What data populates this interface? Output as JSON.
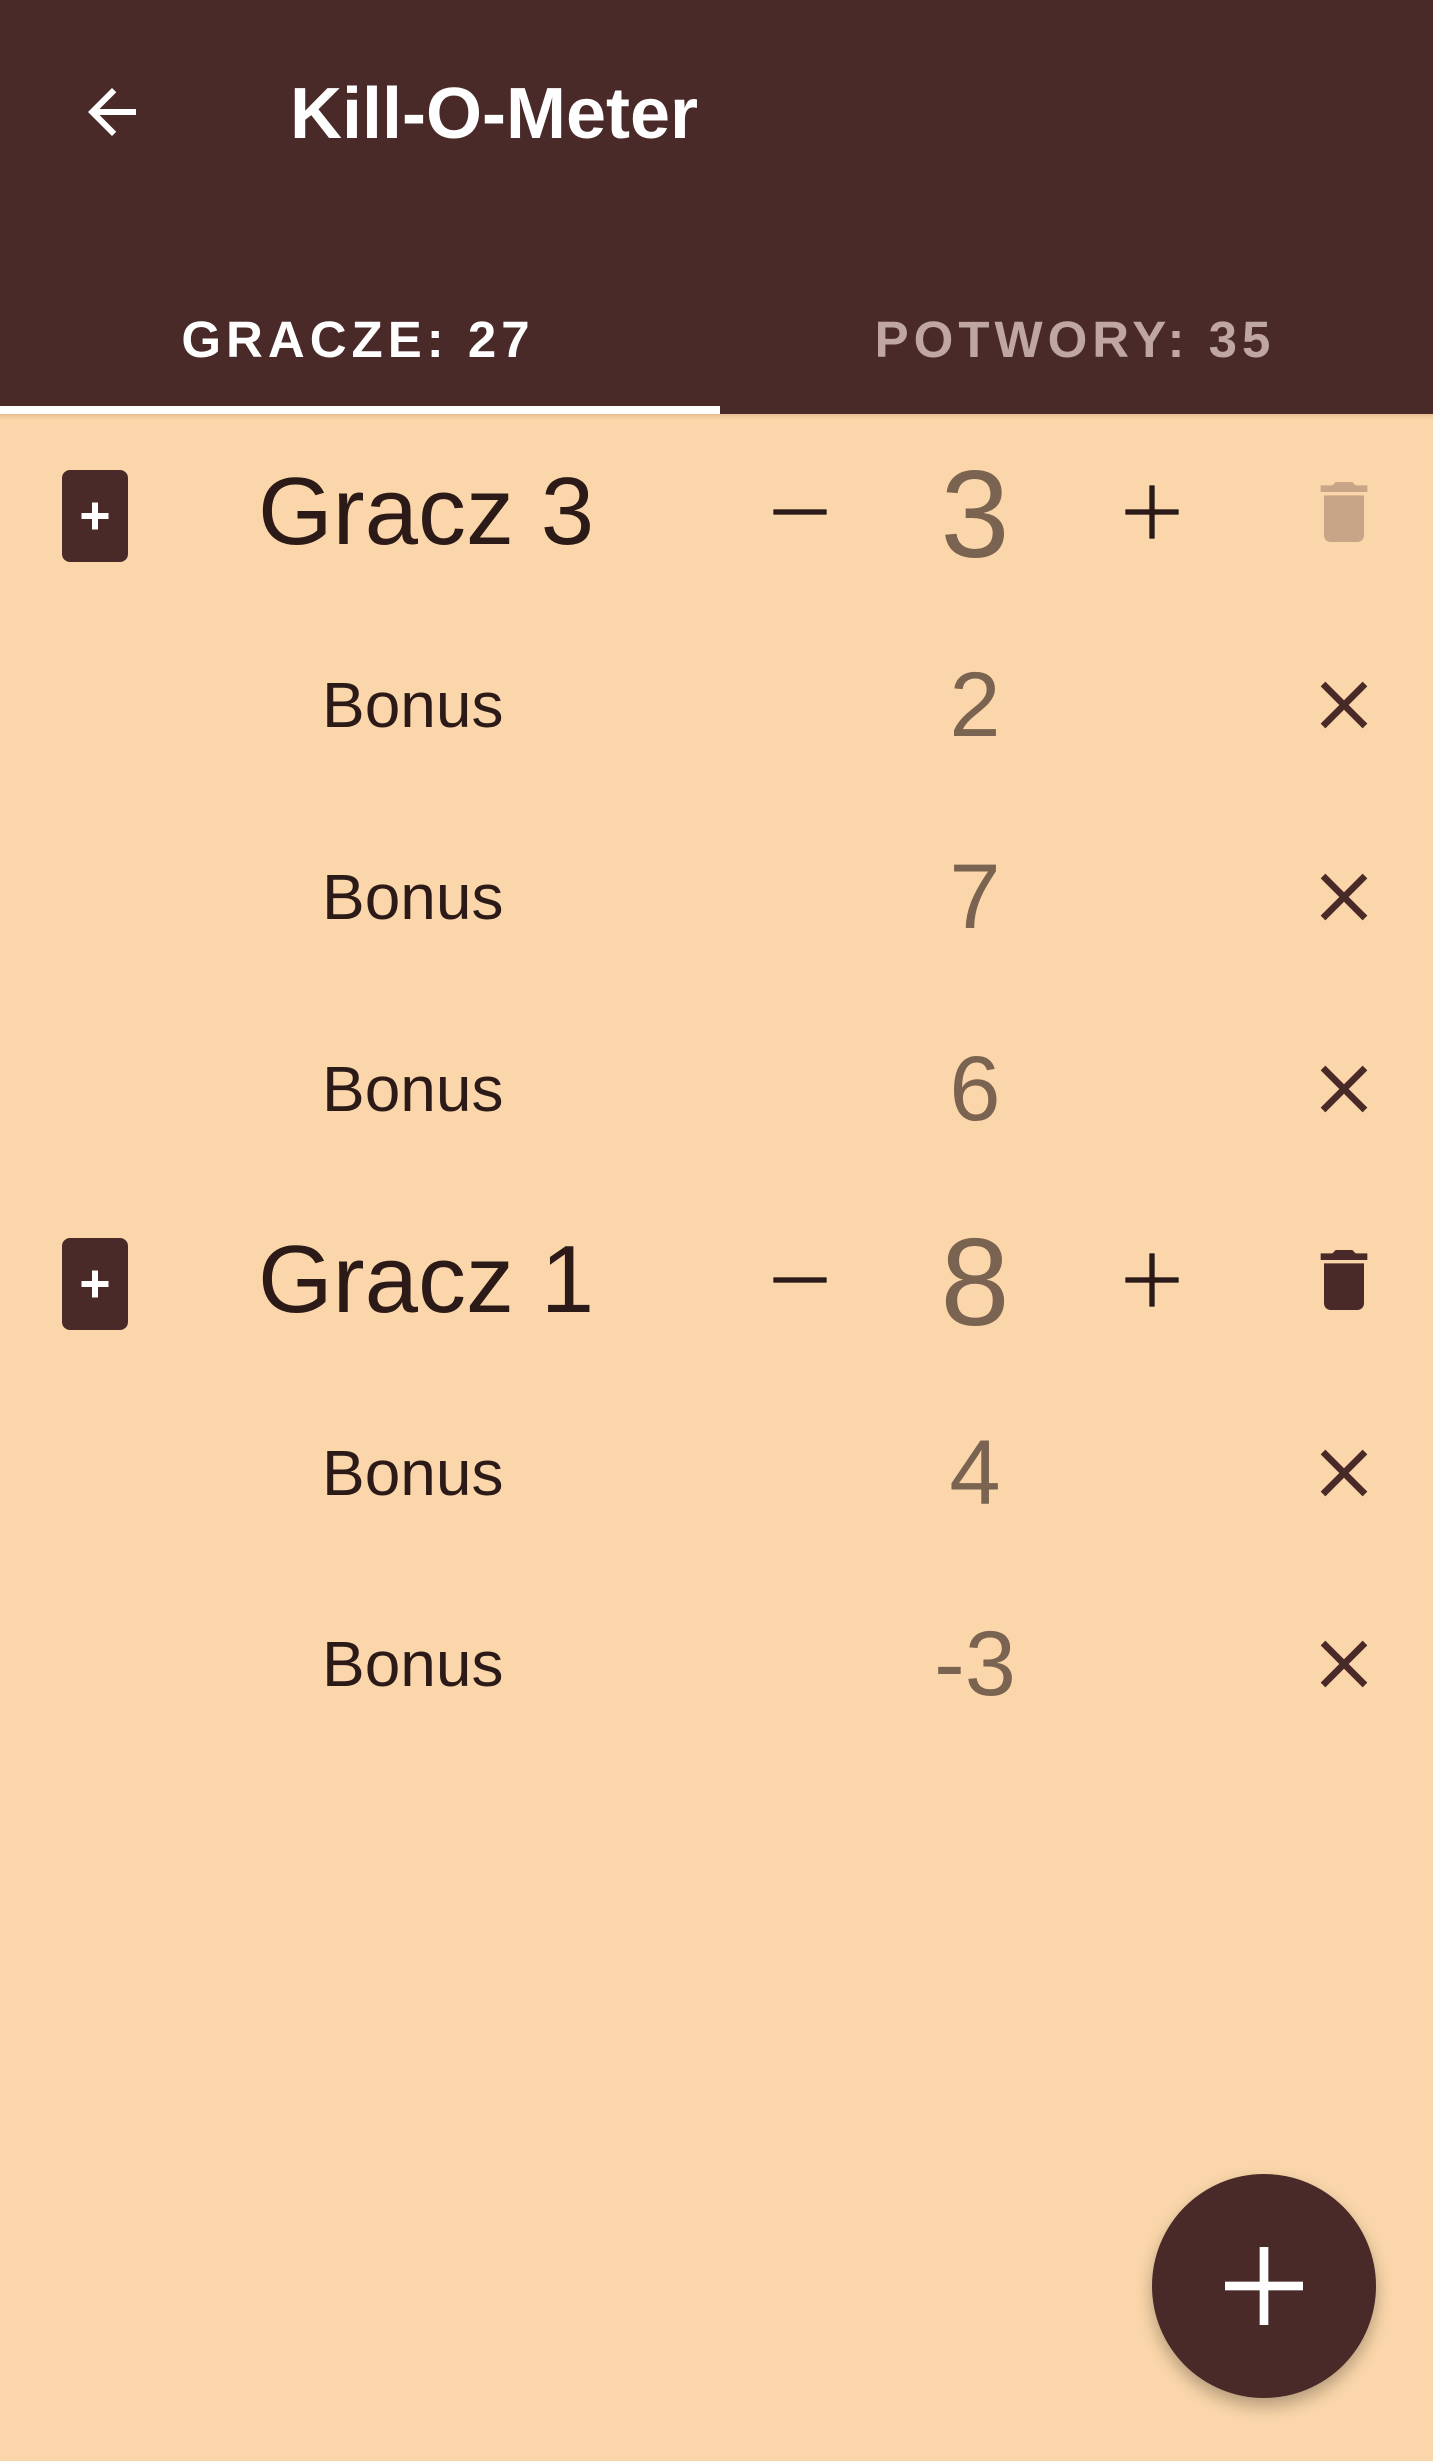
{
  "app": {
    "title": "Kill-O-Meter",
    "icons": {
      "back": "arrow-back-icon"
    }
  },
  "tabs": [
    {
      "label": "GRACZE: 27",
      "selected": true
    },
    {
      "label": "POTWORY: 35",
      "selected": false
    }
  ],
  "players": [
    {
      "name": "Gracz 3",
      "score": "3",
      "delete_enabled": false,
      "bonuses": [
        {
          "label": "Bonus",
          "value": "2"
        },
        {
          "label": "Bonus",
          "value": "7"
        },
        {
          "label": "Bonus",
          "value": "6"
        }
      ]
    },
    {
      "name": "Gracz 1",
      "score": "8",
      "delete_enabled": true,
      "bonuses": [
        {
          "label": "Bonus",
          "value": "4"
        },
        {
          "label": "Bonus",
          "value": "-3"
        }
      ]
    }
  ],
  "colors": {
    "app_bar": "#4A2A28",
    "background": "#FAD6AA",
    "score_text": "#7A6350",
    "disabled_icon": "#C9A587"
  },
  "fab": {
    "icon": "add-icon"
  }
}
